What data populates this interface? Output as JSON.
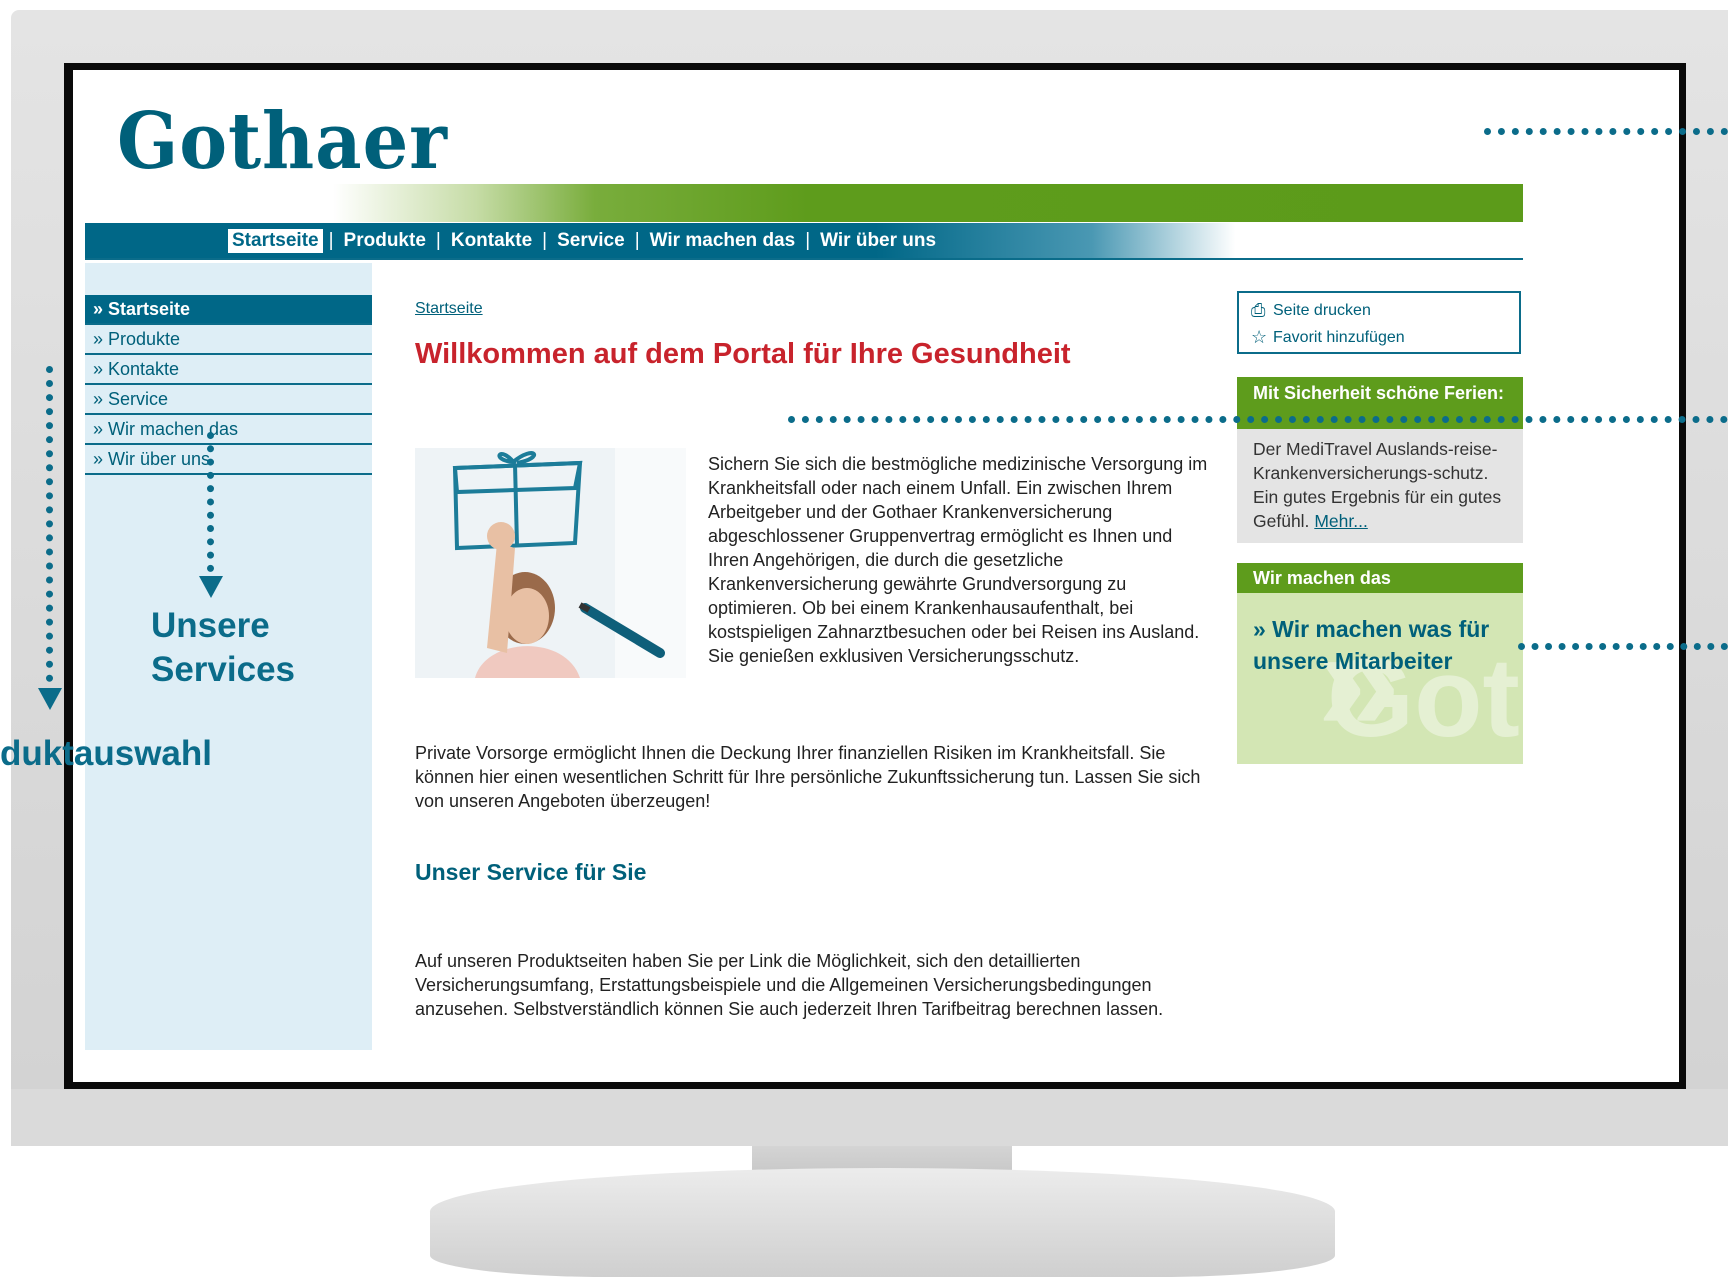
{
  "site": {
    "logo": "Gothaer",
    "topnav": {
      "items": [
        "Startseite",
        "Produkte",
        "Kontakte",
        "Service",
        "Wir machen das",
        "Wir über uns"
      ],
      "separator": "|",
      "active": "Startseite"
    },
    "sidebar": {
      "items": [
        "» Startseite",
        "» Produkte",
        "» Kontakte",
        "» Service",
        "» Wir machen das",
        "» Wir über uns"
      ],
      "active": "» Startseite"
    },
    "breadcrumb": "Startseite",
    "headline": "Willkommen auf dem Portal für Ihre Gesundheit",
    "intro": "Sichern Sie sich die bestmögliche medizinische Versorgung im Krankheitsfall oder nach einem Unfall. Ein zwischen Ihrem Arbeitgeber und der Gothaer Krankenversicherung abgeschlossener Gruppenvertrag ermöglicht es Ihnen und Ihren Angehörigen, die durch die gesetzliche Krankenversicherung gewährte Grundversorgung zu optimieren. Ob bei einem Krankenhausaufenthalt, bei kostspieligen Zahnarztbesuchen oder bei Reisen ins Ausland. Sie genießen exklusiven Versicherungsschutz.",
    "paragraph2": "Private Vorsorge ermöglicht Ihnen die Deckung Ihrer finanziellen Risiken im Krankheitsfall. Sie können hier einen wesentlichen Schritt für Ihre persönliche Zukunftssicherung tun. Lassen Sie sich von unseren Angeboten überzeugen!",
    "section_title": "Unser Service für Sie",
    "paragraph3": "Auf unseren Produktseiten haben Sie per Link die Möglichkeit, sich den detaillierten Versicherungsumfang, Erstattungsbeispiele und die Allgemeinen Versicherungsbedingungen anzusehen. Selbstverständlich können Sie auch jederzeit Ihren Tarifbeitrag berechnen lassen.",
    "tools": {
      "print": "Seite drucken",
      "print_icon": "printer-icon",
      "favorite": "Favorit hinzufügen",
      "favorite_icon": "star-icon"
    },
    "teaser1": {
      "title": "Mit Sicherheit schöne Ferien:",
      "text": "Der MediTravel Auslands-reise-Krankenversicherungs-schutz. Ein gutes Ergebnis für ein gutes Gefühl.",
      "link": "Mehr..."
    },
    "teaser2": {
      "title": "Wir machen das",
      "link": "» Wir machen was für unsere Mitarbeiter",
      "watermark": "Goth"
    }
  },
  "annotations": {
    "services_line1": "Unsere",
    "services_line2": "Services",
    "produktauswahl": "duktauswahl"
  },
  "colors": {
    "brand_teal": "#006787",
    "brand_green": "#5e9c1c",
    "headline_red": "#c8232c",
    "sidebar_bg": "#deeef6"
  }
}
